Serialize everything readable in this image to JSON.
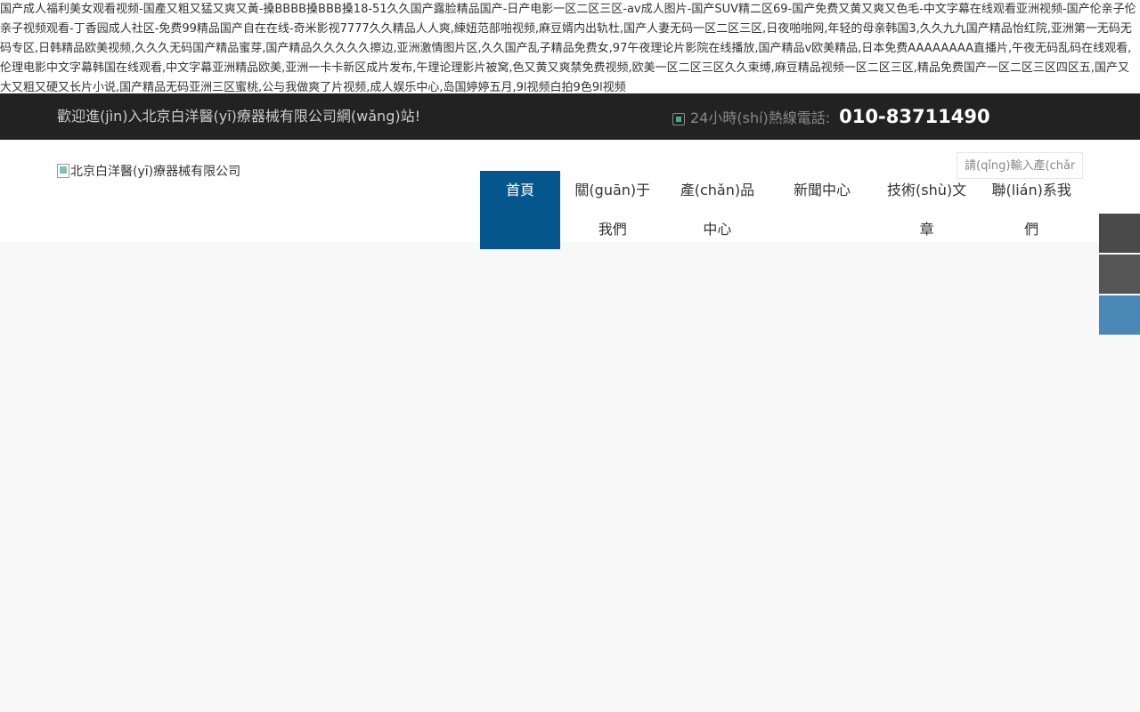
{
  "spam_text": "国产成人福利美女观看视频-国產又粗又猛又爽又黃-搡BBBB搡BBB搡18-51久久国产露脸精品国产-日产电影一区二区三区-av成人图片-国产SUV精二区69-国产免费又黄又爽又色毛-中文字幕在线观看亚洲视频-国产伦亲子伦亲子视频观看-丁香园成人社区-免费99精品国产自在在线-奇米影视7777久久精品人人爽,練妞范部啪视频,麻豆婿内出轨杜,国产人妻无码一区二区三区,日夜啪啪网,年轻的母亲韩国3,久久九九国产精品怡红院,亚洲第一无码无码专区,日韩精品欧美视频,久久久无码国产精品蜜芽,国产精品久久久久久擦边,亚洲激情图片区,久久国产乱子精品免费女,97午夜理论片影院在线播放,国产精品v欧美精品,日本免费AAAAAAAA直播片,午夜无码乱码在线观看,伦理电影中文字幕韩国在线观看,中文字幕亚洲精品欧美,亚洲一卡卡新区成片发布,午理论理影片被窝,色又黄又爽禁免费视频,欧美一区二区三区久久束缚,麻豆精品视频一区二区三区,精品免费国产一区二区三区四区五,国产又大又粗又硬又长片小说,国产精品无码亚洲三区蜜桃,公与我做爽了片视频,成人娱乐中心,岛国婷婷五月,9l视频白拍9色9l视频",
  "topbar": {
    "welcome": "歡迎進(jìn)入北京白洋醫(yī)療器械有限公司網(wǎng)站!",
    "hotline_label": "24小時(shí)熱線電話:",
    "hotline_number": "010-83711490"
  },
  "header": {
    "logo_alt": "北京白洋醫(yī)療器械有限公司",
    "search_placeholder": "請(qǐng)輸入產(chǎn)品名稱"
  },
  "nav": {
    "items": [
      {
        "label": "首頁"
      },
      {
        "label": "關(guān)于我們"
      },
      {
        "label": "產(chǎn)品中心"
      },
      {
        "label": "新聞中心"
      },
      {
        "label": "技術(shù)文章"
      },
      {
        "label": "聯(lián)系我們"
      }
    ]
  },
  "colors": {
    "topbar_bg": "#222222",
    "nav_active_bg": "#05568d",
    "side_blue": "#4a88b8"
  }
}
